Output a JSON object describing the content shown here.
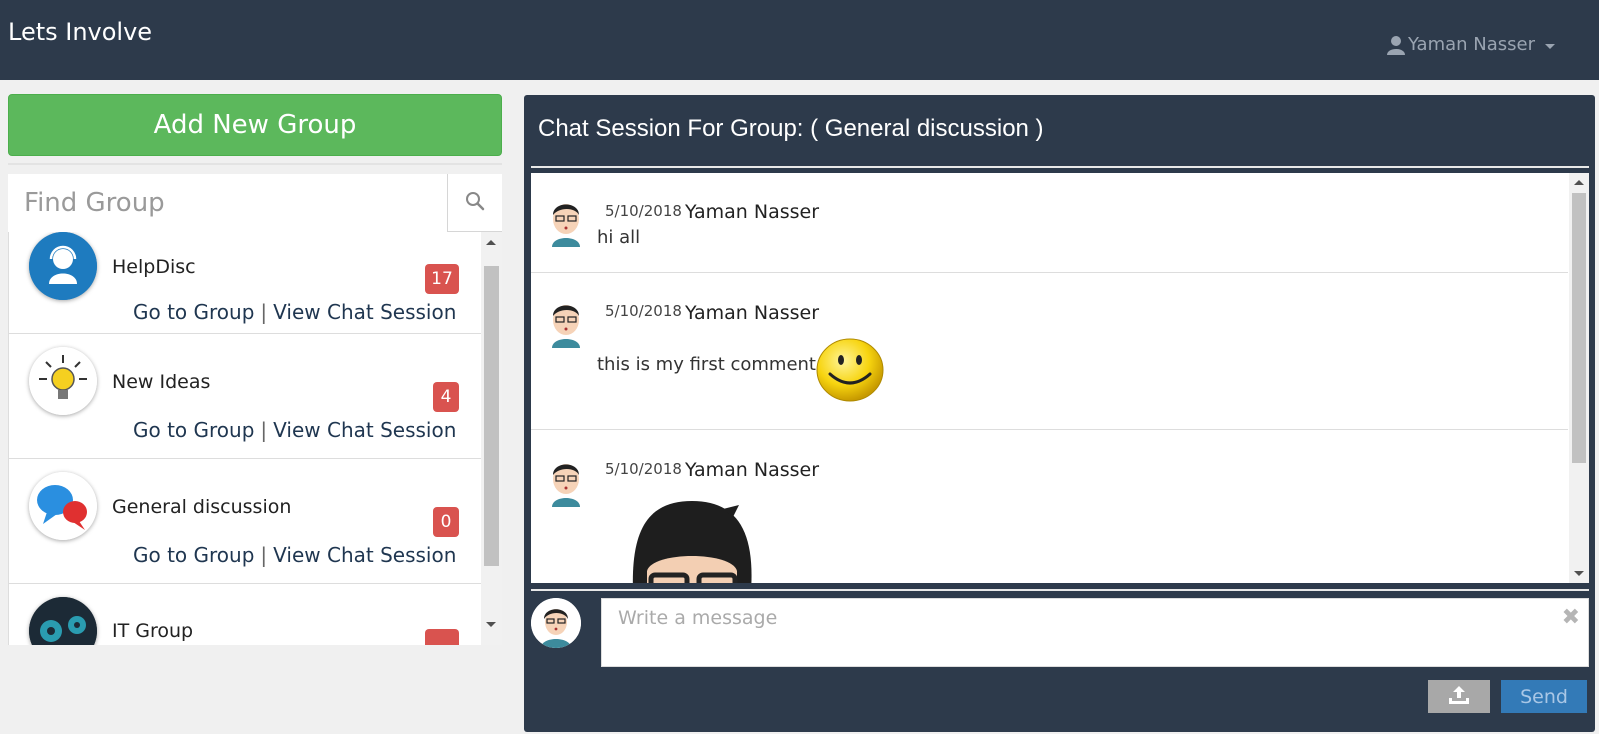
{
  "app": {
    "title": "Lets Involve"
  },
  "user_menu": {
    "name": "Yaman Nasser",
    "icon": "user-icon"
  },
  "sidebar": {
    "add_group_label": "Add New Group",
    "search": {
      "placeholder": "Find Group",
      "value": "",
      "icon": "search-icon"
    },
    "groups": [
      {
        "name": "HelpDisc",
        "badge": "17",
        "go_label": "Go to Group",
        "sep": "|",
        "view_label": "View Chat Session",
        "icon": "helpdesk-icon"
      },
      {
        "name": "New Ideas",
        "badge": "4",
        "go_label": "Go to Group",
        "sep": "|",
        "view_label": "View Chat Session",
        "icon": "lightbulb-icon"
      },
      {
        "name": "General discussion",
        "badge": "0",
        "go_label": "Go to Group",
        "sep": "|",
        "view_label": "View Chat Session",
        "icon": "speech-bubbles-icon"
      },
      {
        "name": "IT Group",
        "badge": "",
        "icon": "gears-icon"
      }
    ]
  },
  "chat": {
    "title": "Chat Session For Group: ( General discussion )",
    "messages": [
      {
        "date": "5/10/2018",
        "author": "Yaman Nasser",
        "text": "hi all"
      },
      {
        "date": "5/10/2018",
        "author": "Yaman Nasser",
        "text": "this is my first comment",
        "emoji": "smiley-icon"
      },
      {
        "date": "5/10/2018",
        "author": "Yaman Nasser",
        "text": "",
        "image": "avatar-illustration"
      }
    ],
    "composer": {
      "placeholder": "Write a message",
      "value": "",
      "clear_icon": "close-icon"
    },
    "upload_icon": "upload-icon",
    "send_label": "Send"
  },
  "colors": {
    "topbar": "#2d3a4b",
    "add_button": "#5cb85c",
    "badge": "#d9534f",
    "send": "#337ab7"
  }
}
